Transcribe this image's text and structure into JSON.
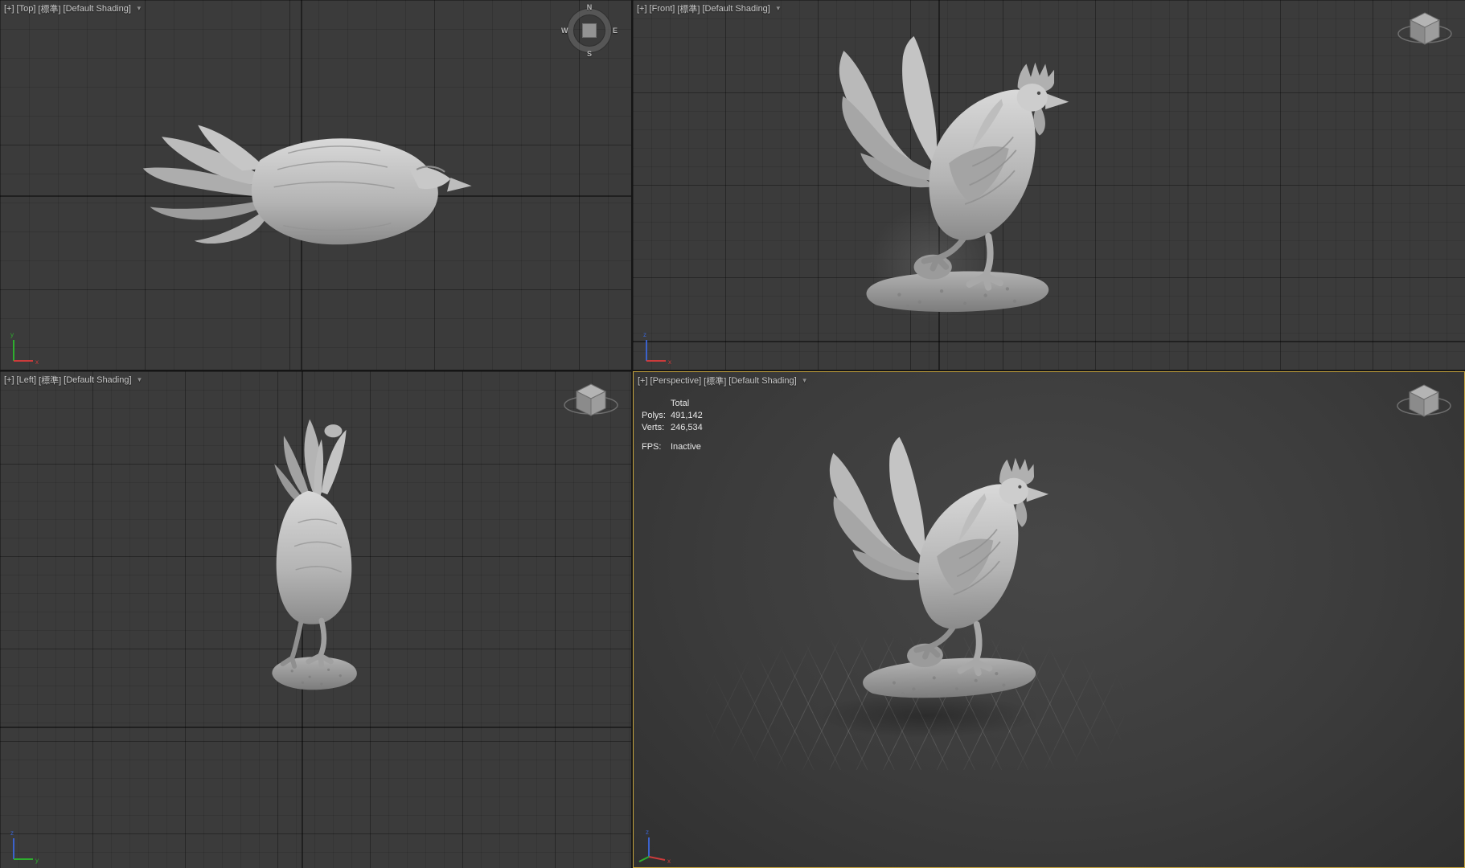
{
  "viewports": {
    "top": {
      "plus": "[+]",
      "view": "[Top]",
      "style": "[標準]",
      "shading": "[Default Shading]"
    },
    "front": {
      "plus": "[+]",
      "view": "[Front]",
      "style": "[標準]",
      "shading": "[Default Shading]"
    },
    "left": {
      "plus": "[+]",
      "view": "[Left]",
      "style": "[標準]",
      "shading": "[Default Shading]"
    },
    "perspective": {
      "plus": "[+]",
      "view": "[Perspective]",
      "style": "[標準]",
      "shading": "[Default Shading]"
    }
  },
  "statistics": {
    "total_label": "Total",
    "polys_label": "Polys:",
    "polys_value": "491,142",
    "verts_label": "Verts:",
    "verts_value": "246,534",
    "fps_label": "FPS:",
    "fps_value": "Inactive"
  },
  "compass": {
    "n": "N",
    "e": "E",
    "s": "S",
    "w": "W"
  },
  "tripod": {
    "x": "x",
    "y": "y",
    "z": "z"
  },
  "icons": {
    "dropdown_arrow": "▼"
  },
  "colors": {
    "active_viewport_border": "#c7a53e",
    "viewport_background": "#3b3b3b"
  }
}
